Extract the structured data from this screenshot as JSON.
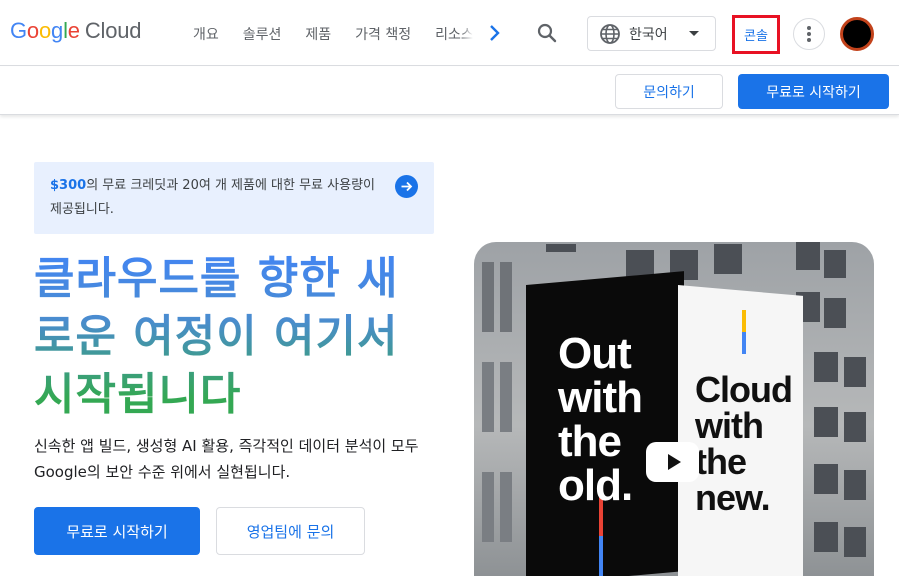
{
  "header": {
    "logo_google": "Google",
    "logo_cloud": "Cloud",
    "nav": [
      "개요",
      "솔루션",
      "제품",
      "가격 책정",
      "리소스"
    ],
    "language": "한국어",
    "console_label": "콘솔"
  },
  "subbar": {
    "contact_label": "문의하기",
    "start_label": "무료로 시작하기"
  },
  "promo": {
    "amount": "$300",
    "text": "의 무료 크레딧과 20여 개 제품에 대한 무료 사용량이 제공됩니다."
  },
  "hero": {
    "headline": "클라우드를 향한 새로운 여정이 여기서 시작됩니다",
    "description": "신속한 앱 빌드, 생성형 AI 활용, 즉각적인 데이터 분석이 모두 Google의 보안 수준 위에서 실현됩니다.",
    "cta_primary": "무료로 시작하기",
    "cta_secondary": "영업팀에 문의",
    "billboard_left": "Out with the old.",
    "billboard_right": "Cloud with the new."
  },
  "colors": {
    "brand_blue": "#1a73e8",
    "highlight_border": "#e81123"
  }
}
